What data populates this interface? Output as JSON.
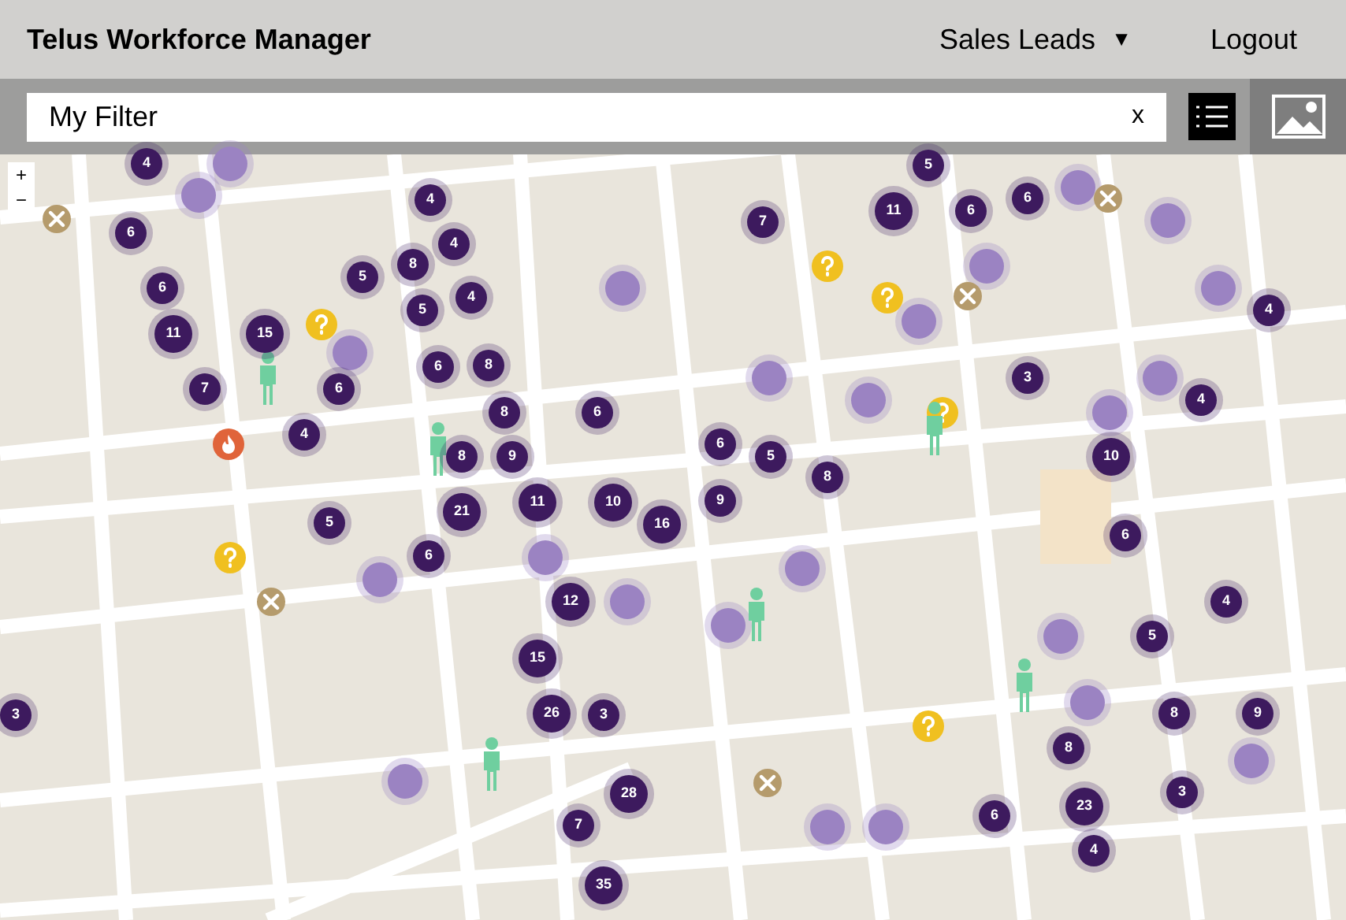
{
  "header": {
    "title": "Telus Workforce Manager",
    "menu": {
      "label": "Sales Leads",
      "caret": "▼"
    },
    "logout": "Logout"
  },
  "filter": {
    "value": "My Filter",
    "clear": "x"
  },
  "map": {
    "zoom_in": "+",
    "zoom_out": "−",
    "clusters": [
      {
        "count": "4"
      },
      {
        "count": "6"
      },
      {
        "count": "6"
      },
      {
        "count": "11"
      },
      {
        "count": "15"
      },
      {
        "count": "7"
      },
      {
        "count": "6"
      },
      {
        "count": "4"
      },
      {
        "count": "4"
      },
      {
        "count": "4"
      },
      {
        "count": "8"
      },
      {
        "count": "5"
      },
      {
        "count": "5"
      },
      {
        "count": "4"
      },
      {
        "count": "6"
      },
      {
        "count": "8"
      },
      {
        "count": "8"
      },
      {
        "count": "6"
      },
      {
        "count": "8"
      },
      {
        "count": "9"
      },
      {
        "count": "11"
      },
      {
        "count": "10"
      },
      {
        "count": "21"
      },
      {
        "count": "16"
      },
      {
        "count": "5"
      },
      {
        "count": "6"
      },
      {
        "count": "7"
      },
      {
        "count": "11"
      },
      {
        "count": "6"
      },
      {
        "count": "6"
      },
      {
        "count": "5"
      },
      {
        "count": "4"
      },
      {
        "count": "3"
      },
      {
        "count": "4"
      },
      {
        "count": "6"
      },
      {
        "count": "5"
      },
      {
        "count": "9"
      },
      {
        "count": "8"
      },
      {
        "count": "10"
      },
      {
        "count": "6"
      },
      {
        "count": "12"
      },
      {
        "count": "15"
      },
      {
        "count": "4"
      },
      {
        "count": "5"
      },
      {
        "count": "26"
      },
      {
        "count": "3"
      },
      {
        "count": "8"
      },
      {
        "count": "9"
      },
      {
        "count": "8"
      },
      {
        "count": "3"
      },
      {
        "count": "28"
      },
      {
        "count": "7"
      },
      {
        "count": "6"
      },
      {
        "count": "23"
      },
      {
        "count": "4"
      },
      {
        "count": "35"
      },
      {
        "count": "3"
      }
    ],
    "pins": [
      {
        "kind": "lead"
      },
      {
        "kind": "lead"
      },
      {
        "kind": "lead"
      },
      {
        "kind": "lead"
      },
      {
        "kind": "lead"
      },
      {
        "kind": "lead"
      },
      {
        "kind": "lead"
      },
      {
        "kind": "lead"
      },
      {
        "kind": "lead"
      },
      {
        "kind": "lead"
      },
      {
        "kind": "lead"
      },
      {
        "kind": "lead"
      },
      {
        "kind": "lead"
      },
      {
        "kind": "lead"
      },
      {
        "kind": "lead"
      },
      {
        "kind": "lead"
      },
      {
        "kind": "lead"
      },
      {
        "kind": "lead"
      },
      {
        "kind": "lead"
      },
      {
        "kind": "lead"
      },
      {
        "kind": "lead"
      },
      {
        "kind": "lead"
      },
      {
        "kind": "lead"
      },
      {
        "kind": "lead"
      },
      {
        "kind": "question"
      },
      {
        "kind": "question"
      },
      {
        "kind": "question"
      },
      {
        "kind": "question"
      },
      {
        "kind": "question"
      },
      {
        "kind": "question"
      },
      {
        "kind": "tools"
      },
      {
        "kind": "tools"
      },
      {
        "kind": "tools"
      },
      {
        "kind": "tools"
      },
      {
        "kind": "tools"
      },
      {
        "kind": "fire"
      },
      {
        "kind": "worker"
      },
      {
        "kind": "worker"
      },
      {
        "kind": "worker"
      },
      {
        "kind": "worker"
      },
      {
        "kind": "worker"
      },
      {
        "kind": "worker"
      }
    ]
  }
}
